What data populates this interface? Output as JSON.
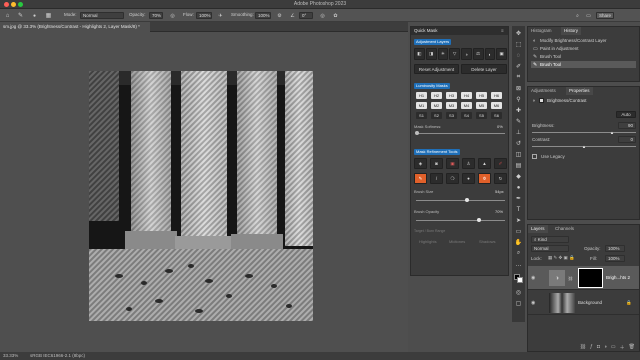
{
  "app": {
    "title": "Adobe Photoshop 2023",
    "colors": {
      "accent": "#1f6fb8",
      "chrome": "#3c3c3c",
      "panel": "#3c3c3c",
      "canvas_bg": "#4f4f4f",
      "highlight_tool": "#e0602a"
    }
  },
  "options_bar": {
    "mode_label": "Mode:",
    "mode_value": "Normal",
    "opacity_label": "Opacity:",
    "opacity_value": "70%",
    "flow_label": "Flow:",
    "flow_value": "100%",
    "smoothing_label": "Smoothing:",
    "smoothing_value": "100%",
    "angle_value": "0°",
    "share_label": "Share"
  },
  "document": {
    "tab_title": "sm.jpg @ 33.3% (Brightness/Contrast - Highlights 2, Layer Mask/8) *",
    "status_zoom": "33.33%",
    "status_info": "sRGB IEC61966-2.1 (8bpc)"
  },
  "quick_mask": {
    "title": "Quick Mask",
    "adjustment_layers_label": "Adjustment Layers",
    "reset_adjustment": "Reset Adjustment",
    "delete_layer": "Delete Layer",
    "luminosity_masks_label": "Luminosity Masks",
    "lum_row1": [
      "H1",
      "H2",
      "H3",
      "H4",
      "H5",
      "H6"
    ],
    "lum_row2": [
      "M1",
      "M2",
      "M3",
      "M4",
      "M5",
      "M6"
    ],
    "lum_row3": [
      "S1",
      "S2",
      "S3",
      "S4",
      "S5",
      "S6"
    ],
    "mask_softness_label": "Mask Softness:",
    "mask_softness_value": "0%",
    "mask_refinement_label": "Mask Refinement Tools",
    "brush_size_label": "Brush Size",
    "brush_size_value": "54px",
    "brush_opacity_label": "Brush Opacity",
    "brush_opacity_value": "70%",
    "range_label": "Target / Burn Range",
    "range_options": [
      "Highlights",
      "Midtones",
      "Shadows"
    ]
  },
  "history": {
    "tab_histogram": "Histogram",
    "tab_history": "History",
    "items": [
      {
        "label": "Modify Brightness/Contrast Layer",
        "icon": "adjust-icon"
      },
      {
        "label": "Paint in Adjustment",
        "icon": "layer-icon"
      },
      {
        "label": "Brush Tool",
        "icon": "brush-icon"
      },
      {
        "label": "Brush Tool",
        "icon": "brush-icon"
      }
    ]
  },
  "properties": {
    "tab_adjustments": "Adjustments",
    "tab_properties": "Properties",
    "layer_name": "Brightness/Contrast",
    "auto_label": "Auto",
    "brightness_label": "Brightness:",
    "brightness_value": "90",
    "contrast_label": "Contrast:",
    "contrast_value": "0",
    "use_legacy_label": "Use Legacy"
  },
  "layers": {
    "tab_layers": "Layers",
    "tab_channels": "Channels",
    "kind_label": "Kind",
    "blend_mode": "Normal",
    "opacity_label": "Opacity:",
    "opacity_value": "100%",
    "lock_label": "Lock:",
    "fill_label": "Fill:",
    "fill_value": "100%",
    "items": [
      {
        "name": "Brigh...hts 2"
      },
      {
        "name": "Background"
      }
    ]
  }
}
